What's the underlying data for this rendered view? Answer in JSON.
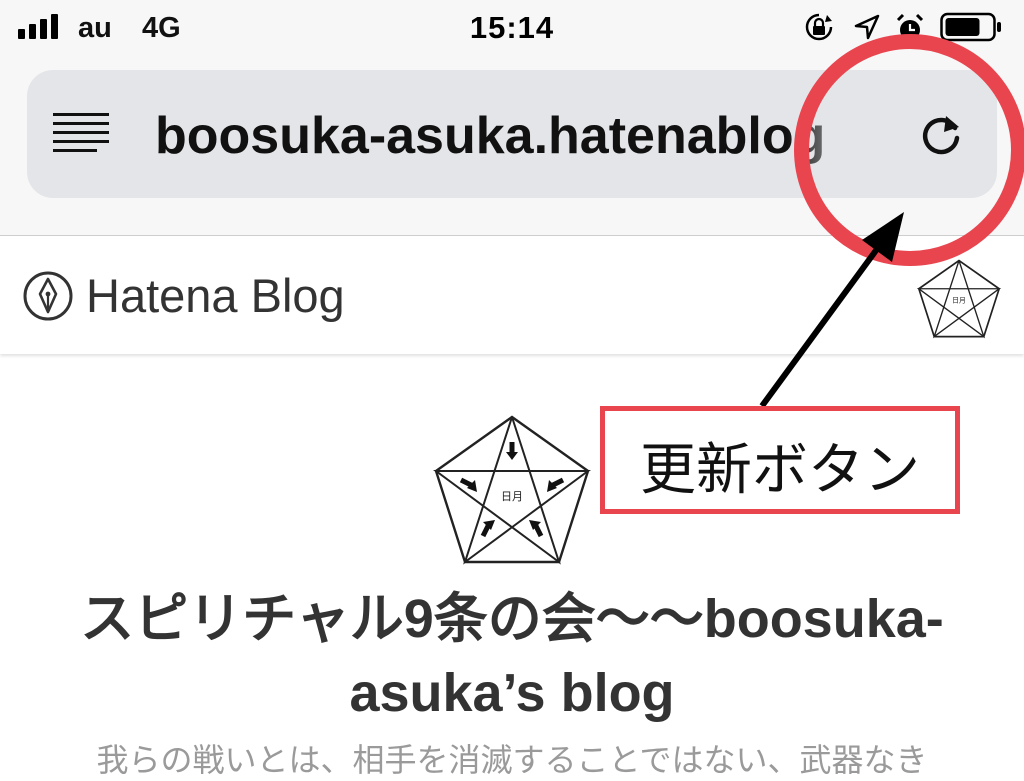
{
  "status_bar": {
    "carrier": "au",
    "network": "4G",
    "time": "15:14",
    "icons": [
      "signal-bars-icon",
      "orientation-lock-icon",
      "location-arrow-icon",
      "alarm-icon",
      "battery-icon"
    ]
  },
  "address_bar": {
    "url": "boosuka-asuka.hatenablog",
    "menu_icon": "reader-lines-icon",
    "reload_icon": "reload-icon"
  },
  "site_header": {
    "logo_icon": "hatena-pen-icon",
    "brand": "Hatena Blog",
    "avatar_icon": "pentagram-avatar-icon",
    "avatar_text": "日月"
  },
  "blog": {
    "image_text": "日月",
    "title": "スピリチャル9条の会～～boosuka-asuka’s blog",
    "tagline": "我らの戦いとは、相手を消滅することではない、武器なき"
  },
  "annotation": {
    "label": "更新ボタン",
    "color": "#e8454f"
  },
  "colors": {
    "chrome_bg": "#f7f7f7",
    "urlbar_bg": "#e4e5e8",
    "accent_red": "#e8454f"
  }
}
